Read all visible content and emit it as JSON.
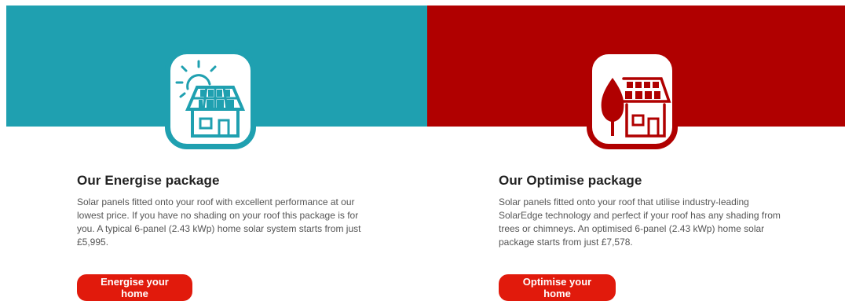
{
  "colors": {
    "energise": "#1fa0b0",
    "optimise": "#b00000",
    "cta": "#e11a0c"
  },
  "packages": [
    {
      "title": "Our Energise package",
      "description": "Solar panels fitted onto your roof with excellent performance at our lowest price. If you have no shading on your roof this package is for you. A typical 6-panel (2.43 kWp) home solar system starts from just £5,995.",
      "cta_label": "Energise your home",
      "icon": "house-with-sun-solar-icon"
    },
    {
      "title": "Our Optimise package",
      "description": "Solar panels fitted onto your roof that utilise industry-leading SolarEdge technology and perfect if your roof has any shading from trees or chimneys. An optimised 6-panel (2.43 kWp) home solar package starts from just £7,578.",
      "cta_label": "Optimise your home",
      "icon": "house-with-tree-solar-icon"
    }
  ]
}
